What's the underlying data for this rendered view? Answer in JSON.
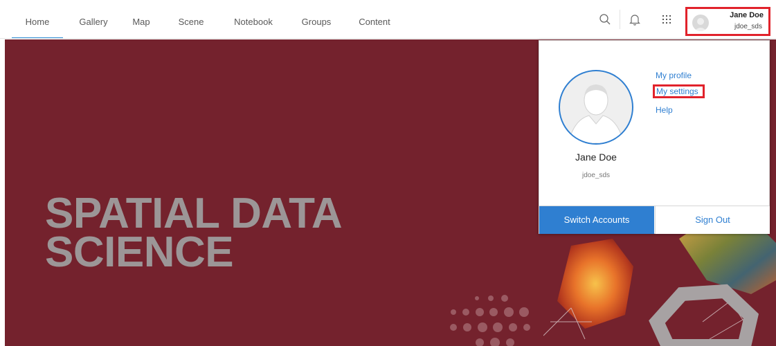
{
  "nav": {
    "items": [
      {
        "label": "Home",
        "active": true
      },
      {
        "label": "Gallery"
      },
      {
        "label": "Map"
      },
      {
        "label": "Scene"
      },
      {
        "label": "Notebook"
      },
      {
        "label": "Groups"
      },
      {
        "label": "Content"
      }
    ],
    "icons": [
      "search-icon",
      "bell-icon",
      "app-launcher-icon"
    ]
  },
  "user_chip": {
    "name": "Jane Doe",
    "username": "jdoe_sds"
  },
  "hero": {
    "title_line1": "SPATIAL DATA",
    "title_line2": "SCIENCE"
  },
  "dropdown": {
    "name": "Jane Doe",
    "username": "jdoe_sds",
    "links": [
      {
        "label": "My profile"
      },
      {
        "label": "My settings",
        "highlighted": true
      },
      {
        "label": "Help"
      }
    ],
    "switch_label": "Switch Accounts",
    "signout_label": "Sign Out"
  },
  "colors": {
    "accent": "#2f7fd1",
    "hero_bg": "#74222d",
    "highlight": "#e1222b"
  }
}
